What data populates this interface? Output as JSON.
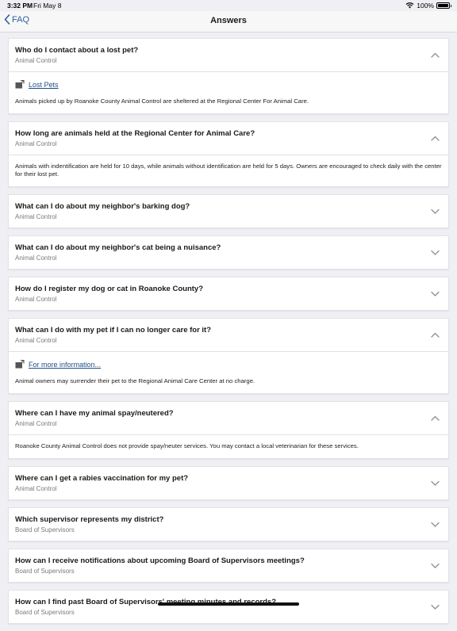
{
  "status": {
    "time": "3:32 PM",
    "date": "Fri May 8",
    "battery": "100%"
  },
  "nav": {
    "back_label": "FAQ",
    "title": "Answers"
  },
  "items": [
    {
      "question": "Who do I contact about a lost pet?",
      "category": "Animal Control",
      "expanded": true,
      "link": "Lost Pets",
      "answer": "Animals picked up by Roanoke County Animal Control are sheltered at the Regional Center For Animal Care."
    },
    {
      "question": "How long are animals held at the Regional Center for Animal Care?",
      "category": "Animal Control",
      "expanded": true,
      "answer": "Animals with indentification are held for 10 days, while animals without identification are held for 5 days.  Owners are encouraged to check daily with the center for their lost pet."
    },
    {
      "question": "What can I do about my neighbor's barking dog?",
      "category": "Animal Control",
      "expanded": false
    },
    {
      "question": "What can I do about my neighbor's cat being a nuisance?",
      "category": "Animal Control",
      "expanded": false
    },
    {
      "question": "How do I register my dog or cat in Roanoke County?",
      "category": "Animal Control",
      "expanded": false
    },
    {
      "question": "What can I do with my pet if I can no longer care for it?",
      "category": "Animal Control",
      "expanded": true,
      "link": "For more information...",
      "answer": "Animal owners may surrender their pet to the Regional Animal Care Center at no charge."
    },
    {
      "question": "Where can I have my animal spay/neutered?",
      "category": "Animal Control",
      "expanded": true,
      "answer": "Roanoke County Animal Control does not provide spay/neuter services.  You may contact a local veterinarian for these services."
    },
    {
      "question": "Where can I get a rabies vaccination for my pet?",
      "category": "Animal Control",
      "expanded": false
    },
    {
      "question": "Which supervisor represents my district?",
      "category": "Board of Supervisors",
      "expanded": false
    },
    {
      "question": "How can I receive notifications about upcoming Board of Supervisors meetings?",
      "category": "Board of Supervisors",
      "expanded": false
    },
    {
      "question": "How can I find past Board of Supervisors' meeting minutes and records?",
      "category": "Board of Supervisors",
      "expanded": false
    }
  ]
}
